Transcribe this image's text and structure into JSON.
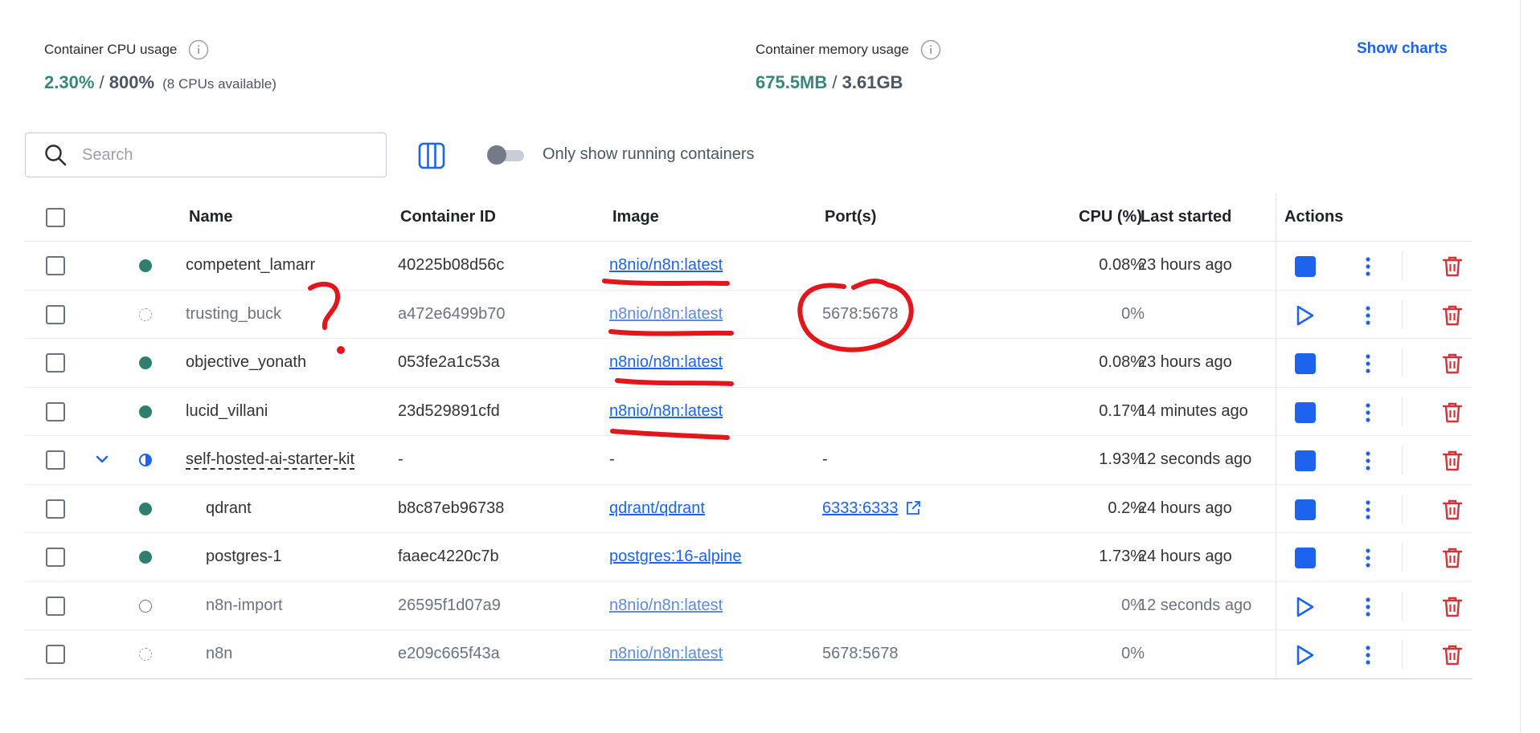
{
  "stats": {
    "cpu": {
      "label": "Container CPU usage",
      "used": "2.30%",
      "separator": " / ",
      "total": "800%",
      "note": "(8 CPUs available)"
    },
    "memory": {
      "label": "Container memory usage",
      "used": "675.5MB",
      "separator": " / ",
      "total": "3.61GB"
    },
    "show_charts": "Show charts"
  },
  "toolbar": {
    "search_placeholder": "Search",
    "toggle_label": "Only show running containers",
    "toggle_on": false
  },
  "table": {
    "headers": {
      "name": "Name",
      "container_id": "Container ID",
      "image": "Image",
      "ports": "Port(s)",
      "cpu": "CPU (%)",
      "last_started": "Last started",
      "actions": "Actions"
    },
    "rows": [
      {
        "name": "competent_lamarr",
        "id": "40225b08d56c",
        "image": "n8nio/n8n:latest",
        "ports": "",
        "cpu": "0.08%",
        "last_started": "23 hours ago",
        "status": "running"
      },
      {
        "name": "trusting_buck",
        "id": "a472e6499b70",
        "image": "n8nio/n8n:latest",
        "ports": "5678:5678",
        "cpu": "0%",
        "last_started": "",
        "status": "created"
      },
      {
        "name": "objective_yonath",
        "id": "053fe2a1c53a",
        "image": "n8nio/n8n:latest",
        "ports": "",
        "cpu": "0.08%",
        "last_started": "23 hours ago",
        "status": "running"
      },
      {
        "name": "lucid_villani",
        "id": "23d529891cfd",
        "image": "n8nio/n8n:latest",
        "ports": "",
        "cpu": "0.17%",
        "last_started": "14 minutes ago",
        "status": "running"
      },
      {
        "name": "self-hosted-ai-starter-kit",
        "id": "-",
        "image": "-",
        "ports": "-",
        "cpu": "1.93%",
        "last_started": "12 seconds ago",
        "status": "partial"
      },
      {
        "name": "qdrant",
        "id": "b8c87eb96738",
        "image": "qdrant/qdrant",
        "ports": "6333:6333",
        "cpu": "0.2%",
        "last_started": "24 hours ago",
        "status": "running"
      },
      {
        "name": "postgres-1",
        "id": "faaec4220c7b",
        "image": "postgres:16-alpine",
        "ports": "",
        "cpu": "1.73%",
        "last_started": "24 hours ago",
        "status": "running"
      },
      {
        "name": "n8n-import",
        "id": "26595f1d07a9",
        "image": "n8nio/n8n:latest",
        "ports": "",
        "cpu": "0%",
        "last_started": "12 seconds ago",
        "status": "exited"
      },
      {
        "name": "n8n",
        "id": "e209c665f43a",
        "image": "n8nio/n8n:latest",
        "ports": "5678:5678",
        "cpu": "0%",
        "last_started": "",
        "status": "created"
      }
    ]
  },
  "colors": {
    "accent": "#1d63ed",
    "running": "#2f7f6f",
    "danger": "#d13438",
    "annotation": "#e3161c"
  },
  "icons": [
    "info-icon",
    "search-icon",
    "columns-icon",
    "chevron-down-icon",
    "stop-icon",
    "play-icon",
    "more-vertical-icon",
    "trash-icon",
    "external-link-icon"
  ]
}
